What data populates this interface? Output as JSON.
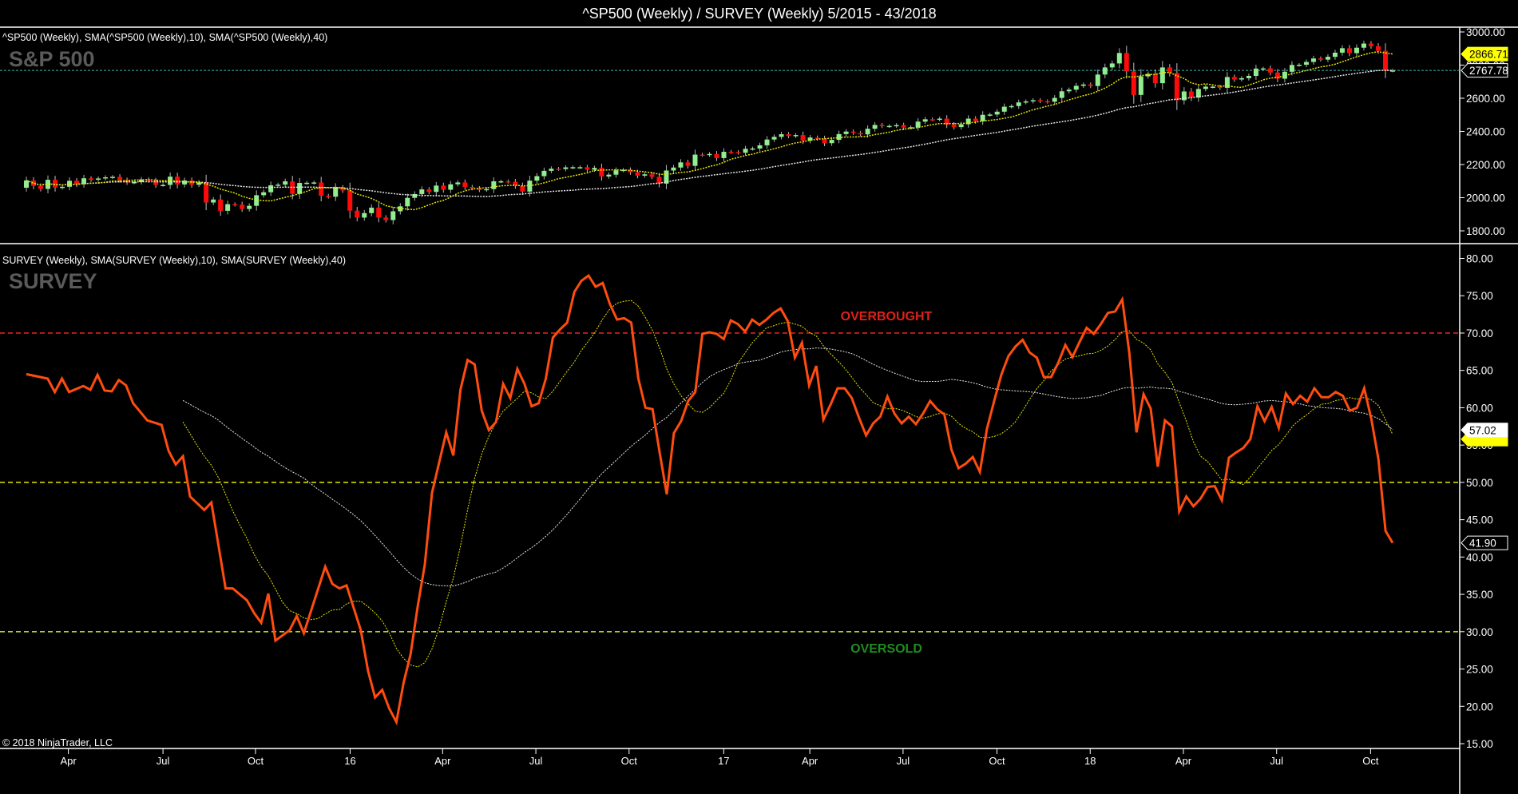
{
  "title": "^SP500 (Weekly) / SURVEY (Weekly)  5/2015 - 43/2018",
  "copyright": "© 2018 NinjaTrader, LLC",
  "colors": {
    "up": "#90ee90",
    "down": "#ff0a0a",
    "sma10": "#e6e600",
    "sma40": "#e8e8e8",
    "survey": "#ff4c0f",
    "overbought": "#e0201a",
    "mid": "#e6e600",
    "oversold": "#b4d21e",
    "last_line": "#3ab5b0"
  },
  "x_axis": {
    "unit": "weeks since start (5/2015)",
    "ticks": [
      {
        "label": "Apr",
        "week": 5.9
      },
      {
        "label": "Jul",
        "week": 19.2
      },
      {
        "label": "Oct",
        "week": 32.2
      },
      {
        "label": "16",
        "week": 45.5
      },
      {
        "label": "Apr",
        "week": 58.5
      },
      {
        "label": "Jul",
        "week": 71.6
      },
      {
        "label": "Oct",
        "week": 84.7
      },
      {
        "label": "17",
        "week": 98
      },
      {
        "label": "Apr",
        "week": 110.1
      },
      {
        "label": "Jul",
        "week": 123.2
      },
      {
        "label": "Oct",
        "week": 136.4
      },
      {
        "label": "18",
        "week": 149.5
      },
      {
        "label": "Apr",
        "week": 162.6
      },
      {
        "label": "Jul",
        "week": 175.7
      },
      {
        "label": "Oct",
        "week": 188.9
      }
    ],
    "last_week": 192
  },
  "chart_data": [
    {
      "type": "candlestick",
      "legend": "^SP500 (Weekly), SMA(^SP500 (Weekly),10), SMA(^SP500 (Weekly),40)",
      "panel_label": "S&P 500",
      "ylim": [
        1800,
        3000
      ],
      "y_ticks": [
        "3000.00",
        "2800.00",
        "2600.00",
        "2400.00",
        "2200.00",
        "2000.00",
        "1800.00"
      ],
      "y_tick_values": [
        3000,
        2800,
        2600,
        2400,
        2200,
        2000,
        1800
      ],
      "first_open": 2060,
      "closes": [
        2104,
        2071,
        2053,
        2108,
        2061,
        2066,
        2102,
        2081,
        2117,
        2108,
        2116,
        2123,
        2126,
        2107,
        2092,
        2094,
        2110,
        2102,
        2077,
        2077,
        2127,
        2080,
        2104,
        2078,
        2092,
        1971,
        1989,
        1921,
        1961,
        1958,
        1932,
        1951,
        2015,
        2033,
        2075,
        2079,
        2099,
        2023,
        2089,
        2090,
        2092,
        2012,
        2006,
        2061,
        2044,
        1922,
        1880,
        1907,
        1940,
        1880,
        1865,
        1918,
        1948,
        1999,
        2022,
        2050,
        2035,
        2073,
        2048,
        2081,
        2092,
        2065,
        2057,
        2047,
        2052,
        2099,
        2099,
        2096,
        2071,
        2037,
        2103,
        2130,
        2162,
        2175,
        2173,
        2183,
        2184,
        2184,
        2169,
        2180,
        2128,
        2139,
        2165,
        2168,
        2153,
        2133,
        2141,
        2126,
        2085,
        2164,
        2182,
        2213,
        2192,
        2260,
        2258,
        2264,
        2239,
        2277,
        2275,
        2271,
        2295,
        2297,
        2316,
        2351,
        2367,
        2383,
        2372,
        2378,
        2344,
        2363,
        2356,
        2329,
        2349,
        2384,
        2399,
        2391,
        2382,
        2416,
        2439,
        2432,
        2433,
        2438,
        2423,
        2425,
        2459,
        2473,
        2472,
        2477,
        2441,
        2426,
        2443,
        2477,
        2461,
        2500,
        2502,
        2519,
        2549,
        2553,
        2575,
        2581,
        2588,
        2582,
        2579,
        2602,
        2642,
        2652,
        2675,
        2683,
        2674,
        2743,
        2786,
        2810,
        2873,
        2762,
        2620,
        2732,
        2747,
        2691,
        2786,
        2752,
        2588,
        2641,
        2604,
        2656,
        2670,
        2670,
        2663,
        2728,
        2713,
        2721,
        2735,
        2779,
        2780,
        2755,
        2718,
        2760,
        2801,
        2802,
        2819,
        2840,
        2833,
        2850,
        2875,
        2902,
        2872,
        2905,
        2930,
        2914,
        2886,
        2767,
        2767.78
      ],
      "markers": {
        "sma10_last": "2866.71",
        "last_close": "2767.78"
      },
      "last_close_value": 2767.78,
      "sma_periods": [
        10,
        40
      ]
    },
    {
      "type": "line",
      "legend": "SURVEY (Weekly), SMA(SURVEY (Weekly),10), SMA(SURVEY (Weekly),40)",
      "panel_label": "SURVEY",
      "ylim": [
        15,
        80
      ],
      "y_ticks": [
        "80.00",
        "75.00",
        "70.00",
        "65.00",
        "60.00",
        "55.00",
        "50.00",
        "45.00",
        "40.00",
        "35.00",
        "30.00",
        "25.00",
        "20.00",
        "15.00"
      ],
      "y_tick_values": [
        80,
        75,
        70,
        65,
        60,
        55,
        50,
        45,
        40,
        35,
        30,
        25,
        20,
        15
      ],
      "levels": [
        {
          "value": 70,
          "label": "OVERBOUGHT",
          "color_key": "overbought"
        },
        {
          "value": 50,
          "label": "",
          "color_key": "mid"
        },
        {
          "value": 30,
          "label": "OVERSOLD",
          "color_key": "oversold"
        }
      ],
      "sma_start_week": 22,
      "points": [
        [
          0,
          64.5
        ],
        [
          3,
          63.9
        ],
        [
          4,
          62.1
        ],
        [
          5,
          63.9
        ],
        [
          6,
          62.1
        ],
        [
          8,
          62.9
        ],
        [
          9,
          62.4
        ],
        [
          10,
          64.4
        ],
        [
          11,
          62.3
        ],
        [
          12,
          62.2
        ],
        [
          13,
          63.7
        ],
        [
          14,
          63.0
        ],
        [
          15,
          60.6
        ],
        [
          17,
          58.3
        ],
        [
          19,
          57.7
        ],
        [
          20,
          54.2
        ],
        [
          21,
          52.4
        ],
        [
          22,
          53.5
        ],
        [
          23,
          48.1
        ],
        [
          25,
          46.3
        ],
        [
          26,
          47.3
        ],
        [
          28,
          35.8
        ],
        [
          29,
          35.8
        ],
        [
          31,
          34.2
        ],
        [
          32,
          32.5
        ],
        [
          33,
          31.2
        ],
        [
          34,
          35.1
        ],
        [
          35,
          28.8
        ],
        [
          37,
          30.2
        ],
        [
          38,
          32.1
        ],
        [
          39,
          29.8
        ],
        [
          42,
          38.7
        ],
        [
          43,
          36.4
        ],
        [
          44,
          35.8
        ],
        [
          45,
          36.2
        ],
        [
          47,
          30.2
        ],
        [
          48,
          24.8
        ],
        [
          49,
          21.2
        ],
        [
          50,
          22.2
        ],
        [
          51,
          19.7
        ],
        [
          52,
          17.9
        ],
        [
          53,
          23.1
        ],
        [
          54,
          27.0
        ],
        [
          55,
          33.4
        ],
        [
          56,
          39.0
        ],
        [
          57,
          48.6
        ],
        [
          59,
          56.7
        ],
        [
          60,
          53.6
        ],
        [
          61,
          62.4
        ],
        [
          62,
          66.4
        ],
        [
          63,
          65.8
        ],
        [
          64,
          59.6
        ],
        [
          65,
          57.0
        ],
        [
          66,
          58.1
        ],
        [
          67,
          63.2
        ],
        [
          68,
          61.3
        ],
        [
          69,
          65.2
        ],
        [
          70,
          63.2
        ],
        [
          71,
          60.2
        ],
        [
          72,
          60.6
        ],
        [
          73,
          63.9
        ],
        [
          74,
          69.4
        ],
        [
          75,
          70.5
        ],
        [
          76,
          71.4
        ],
        [
          77,
          75.5
        ],
        [
          78,
          77.0
        ],
        [
          79,
          77.7
        ],
        [
          80,
          76.2
        ],
        [
          81,
          76.7
        ],
        [
          82,
          73.9
        ],
        [
          83,
          71.8
        ],
        [
          84,
          72.0
        ],
        [
          85,
          71.4
        ],
        [
          86,
          63.9
        ],
        [
          87,
          60.0
        ],
        [
          88,
          59.8
        ],
        [
          89,
          54.0
        ],
        [
          90,
          48.4
        ],
        [
          91,
          56.6
        ],
        [
          92,
          58.2
        ],
        [
          93,
          60.9
        ],
        [
          94,
          62.1
        ],
        [
          95,
          69.9
        ],
        [
          96,
          70.1
        ],
        [
          97,
          69.9
        ],
        [
          98,
          69.2
        ],
        [
          99,
          71.7
        ],
        [
          100,
          71.2
        ],
        [
          101,
          70.2
        ],
        [
          102,
          71.8
        ],
        [
          103,
          71.1
        ],
        [
          104,
          71.8
        ],
        [
          105,
          72.7
        ],
        [
          106,
          73.3
        ],
        [
          107,
          71.6
        ],
        [
          108,
          66.7
        ],
        [
          109,
          68.7
        ],
        [
          110,
          63.0
        ],
        [
          111,
          65.6
        ],
        [
          112,
          58.4
        ],
        [
          113,
          60.4
        ],
        [
          114,
          62.6
        ],
        [
          115,
          62.6
        ],
        [
          116,
          61.3
        ],
        [
          117,
          58.7
        ],
        [
          118,
          56.3
        ],
        [
          119,
          57.9
        ],
        [
          120,
          58.8
        ],
        [
          121,
          61.5
        ],
        [
          122,
          59.2
        ],
        [
          123,
          57.9
        ],
        [
          124,
          58.8
        ],
        [
          125,
          57.8
        ],
        [
          126,
          59.2
        ],
        [
          127,
          60.9
        ],
        [
          128,
          59.8
        ],
        [
          129,
          59.1
        ],
        [
          130,
          54.4
        ],
        [
          131,
          51.9
        ],
        [
          132,
          52.5
        ],
        [
          133,
          53.4
        ],
        [
          134,
          51.4
        ],
        [
          135,
          57.2
        ],
        [
          136,
          60.9
        ],
        [
          137,
          64.4
        ],
        [
          138,
          66.9
        ],
        [
          139,
          68.2
        ],
        [
          140,
          69.1
        ],
        [
          141,
          67.4
        ],
        [
          142,
          66.7
        ],
        [
          143,
          64.1
        ],
        [
          144,
          64.1
        ],
        [
          145,
          66.0
        ],
        [
          146,
          68.4
        ],
        [
          147,
          66.8
        ],
        [
          148,
          68.8
        ],
        [
          149,
          70.7
        ],
        [
          150,
          69.9
        ],
        [
          151,
          71.2
        ],
        [
          152,
          72.7
        ],
        [
          153,
          72.9
        ],
        [
          154,
          74.5
        ],
        [
          155,
          67.3
        ],
        [
          156,
          56.7
        ],
        [
          157,
          61.8
        ],
        [
          158,
          59.9
        ],
        [
          159,
          52.1
        ],
        [
          160,
          58.3
        ],
        [
          161,
          57.5
        ],
        [
          162,
          46.1
        ],
        [
          163,
          48.1
        ],
        [
          164,
          46.8
        ],
        [
          165,
          47.8
        ],
        [
          166,
          49.4
        ],
        [
          167,
          49.5
        ],
        [
          168,
          47.6
        ],
        [
          169,
          53.3
        ],
        [
          170,
          54.0
        ],
        [
          171,
          54.6
        ],
        [
          172,
          55.8
        ],
        [
          173,
          60.2
        ],
        [
          174,
          58.2
        ],
        [
          175,
          60.1
        ],
        [
          176,
          57.3
        ],
        [
          177,
          61.9
        ],
        [
          178,
          60.5
        ],
        [
          179,
          61.6
        ],
        [
          180,
          60.8
        ],
        [
          181,
          62.6
        ],
        [
          182,
          61.4
        ],
        [
          183,
          61.4
        ],
        [
          184,
          62.1
        ],
        [
          185,
          61.6
        ],
        [
          186,
          59.6
        ],
        [
          187,
          60.0
        ],
        [
          188,
          62.6
        ],
        [
          189,
          58.5
        ],
        [
          190,
          53.1
        ],
        [
          191,
          43.5
        ],
        [
          192,
          41.9
        ]
      ],
      "markers": {
        "sma40_last": "57.02",
        "last_value": "41.90"
      },
      "sma_periods": [
        10,
        40
      ]
    }
  ]
}
